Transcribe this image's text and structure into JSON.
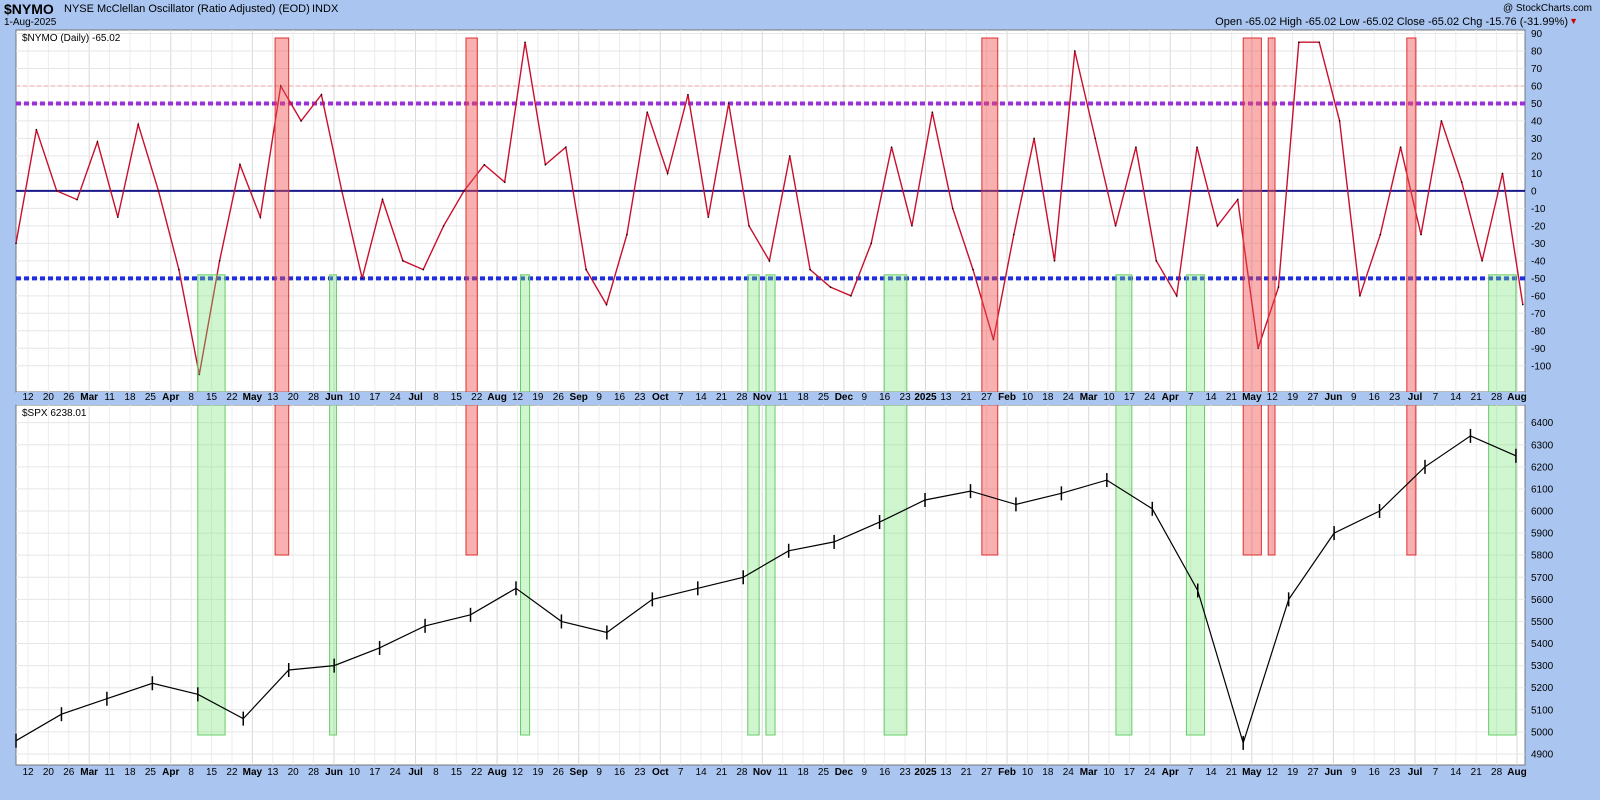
{
  "header": {
    "symbol": "$NYMO",
    "description": "NYSE McClellan Oscillator (Ratio Adjusted) (EOD)",
    "exchange": "INDX",
    "date": "1-Aug-2025",
    "ohlc": "Open -65.02  High -65.02  Low -65.02  Close -65.02  Chg -15.76 (-31.99%)",
    "watermark": "@ StockCharts.com"
  },
  "chart_data": [
    {
      "type": "line",
      "title": "$NYMO (Daily) -65.02",
      "series": [
        {
          "name": "$NYMO (Daily) -65.02"
        }
      ],
      "ylim": [
        -115,
        92
      ],
      "yticks": [
        90,
        80,
        70,
        60,
        50,
        40,
        30,
        20,
        10,
        0,
        -10,
        -20,
        -30,
        -40,
        -50,
        -60,
        -70,
        -80,
        -90,
        -100
      ],
      "reference_lines": [
        {
          "value": 50,
          "style": "dotted",
          "color": "#9b30d9"
        },
        {
          "value": 0,
          "style": "solid",
          "color": "#1a1a8c"
        },
        {
          "value": -50,
          "style": "dotted",
          "color": "#1f2ee0"
        },
        {
          "value": 60,
          "style": "dashed-light",
          "color": "#f0a0a0"
        }
      ],
      "x": [
        0,
        7,
        14,
        21,
        28,
        35,
        42,
        49,
        56,
        63,
        70,
        77,
        84,
        91,
        98,
        105,
        112,
        119,
        126,
        133,
        140,
        147,
        154,
        161,
        168,
        175,
        182,
        189,
        196,
        203,
        210,
        217,
        224,
        231,
        238,
        245,
        252,
        259,
        266,
        273,
        280,
        287,
        294,
        301,
        308,
        315,
        322,
        329,
        336,
        343,
        350,
        357,
        364,
        371,
        378,
        385,
        392,
        399,
        406,
        413,
        420,
        427,
        434,
        441,
        448,
        455,
        462,
        469,
        476,
        483,
        490,
        497,
        504,
        511,
        518
      ],
      "values": [
        -30,
        35,
        0,
        -5,
        28,
        -15,
        38,
        0,
        -45,
        -105,
        -40,
        15,
        -15,
        60,
        40,
        55,
        0,
        -50,
        -5,
        -40,
        -45,
        -20,
        0,
        15,
        5,
        85,
        15,
        25,
        -45,
        -65,
        -25,
        45,
        10,
        55,
        -15,
        50,
        -20,
        -40,
        20,
        -45,
        -55,
        -60,
        -30,
        25,
        -20,
        45,
        -10,
        -45,
        -85,
        -25,
        30,
        -40,
        80,
        30,
        -20,
        25,
        -40,
        -60,
        25,
        -20,
        -5,
        -90,
        -55,
        85,
        85,
        40,
        -60,
        -25,
        25,
        -25,
        40,
        5,
        -40,
        10,
        -65
      ],
      "red_bands": [
        {
          "from": 114,
          "to": 120,
          "ymin": 0.1,
          "ymax": 1
        },
        {
          "from": 198,
          "to": 203,
          "ymin": 0.1,
          "ymax": 1
        },
        {
          "from": 425,
          "to": 432,
          "ymin": 0.1,
          "ymax": 1
        },
        {
          "from": 540,
          "to": 548,
          "ymin": 0.1,
          "ymax": 1
        },
        {
          "from": 551,
          "to": 554,
          "ymin": 0.1,
          "ymax": 1
        },
        {
          "from": 612,
          "to": 616,
          "ymin": 0.1,
          "ymax": 1
        }
      ],
      "green_bands": [
        {
          "from": 80,
          "to": 92
        },
        {
          "from": 138,
          "to": 141
        },
        {
          "from": 222,
          "to": 226
        },
        {
          "from": 322,
          "to": 327
        },
        {
          "from": 330,
          "to": 334
        },
        {
          "from": 382,
          "to": 392
        },
        {
          "from": 484,
          "to": 491
        },
        {
          "from": 515,
          "to": 523
        },
        {
          "from": 648,
          "to": 660
        }
      ]
    },
    {
      "type": "line",
      "title": "$SPX 6238.01",
      "series": [
        {
          "name": "$SPX 6238.01"
        }
      ],
      "ylim": [
        4850,
        6480
      ],
      "yticks": [
        6400,
        6300,
        6200,
        6100,
        6000,
        5900,
        5800,
        5700,
        5600,
        5500,
        5400,
        5300,
        5200,
        5100,
        5000,
        4900
      ],
      "x": [
        0,
        20,
        40,
        60,
        80,
        100,
        120,
        140,
        160,
        180,
        200,
        220,
        240,
        260,
        280,
        300,
        320,
        340,
        360,
        380,
        400,
        420,
        440,
        460,
        480,
        500,
        520,
        540,
        560,
        580,
        600,
        620,
        640,
        660
      ],
      "values": [
        4960,
        5080,
        5150,
        5220,
        5170,
        5060,
        5280,
        5300,
        5380,
        5480,
        5530,
        5650,
        5500,
        5450,
        5600,
        5650,
        5700,
        5820,
        5860,
        5950,
        6050,
        6090,
        6030,
        6080,
        6140,
        6010,
        5640,
        4950,
        5600,
        5900,
        6000,
        6200,
        6340,
        6250
      ]
    }
  ],
  "x_axis": {
    "labels": [
      "12",
      "20",
      "26",
      "Mar",
      "11",
      "18",
      "25",
      "Apr",
      "8",
      "15",
      "22",
      "May",
      "13",
      "20",
      "28",
      "Jun",
      "10",
      "17",
      "24",
      "Jul",
      "8",
      "15",
      "22",
      "Aug",
      "12",
      "19",
      "26",
      "Sep",
      "9",
      "16",
      "23",
      "Oct",
      "7",
      "14",
      "21",
      "28",
      "Nov",
      "11",
      "18",
      "25",
      "Dec",
      "9",
      "16",
      "23",
      "2025",
      "13",
      "21",
      "27",
      "Feb",
      "10",
      "18",
      "24",
      "Mar",
      "10",
      "17",
      "24",
      "Apr",
      "7",
      "14",
      "21",
      "May",
      "12",
      "19",
      "27",
      "Jun",
      "9",
      "16",
      "23",
      "Jul",
      "7",
      "14",
      "21",
      "28",
      "Aug"
    ],
    "months": [
      "Mar",
      "Apr",
      "May",
      "Jun",
      "Jul",
      "Aug",
      "Sep",
      "Oct",
      "Nov",
      "Dec",
      "2025",
      "Feb"
    ]
  }
}
